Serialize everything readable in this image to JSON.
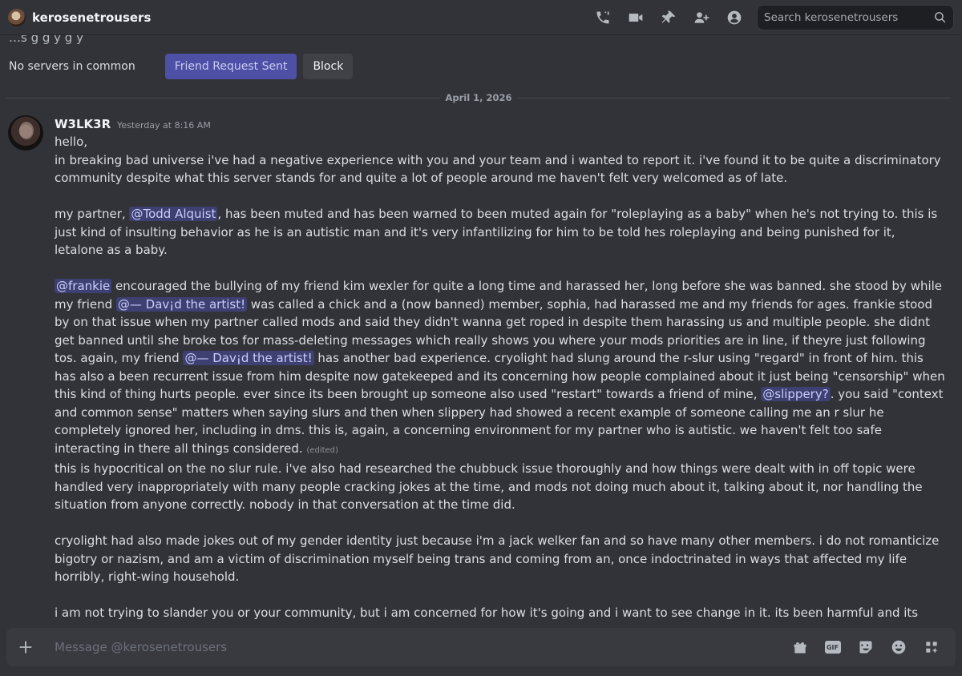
{
  "header": {
    "title": "kerosenetrousers",
    "search_placeholder": "Search kerosenetrousers"
  },
  "profile": {
    "clipped_text": "…s      g  g  y              g    y",
    "no_servers": "No servers in common",
    "friend_request_label": "Friend Request Sent",
    "block_label": "Block"
  },
  "divider": {
    "date": "April 1, 2026"
  },
  "message": {
    "author": "W3LK3R",
    "timestamp": "Yesterday at 8:16 AM",
    "edited": "(edited)",
    "p1_a": "hello,\nin breaking bad universe i've had a negative experience with you and your team and i wanted to report it. i've found it to be quite a discriminatory community despite what this server stands for and quite a lot of people around me haven't felt very welcomed as of late.",
    "p2_a": "my partner, ",
    "p2_mention": "@Todd Alquist",
    "p2_b": ", has been muted and has been warned to been muted again for \"roleplaying as a baby\" when he's not trying to. this is just kind of insulting behavior as he is an autistic man and it's very infantilizing for him to be told hes roleplaying and being punished for it, letalone as a baby.",
    "p3_m1": "@frankie",
    "p3_a": " encouraged the bullying of my friend kim wexler for quite a long time and harassed her, long before she was banned. she stood by while my friend ",
    "p3_m2": "@— Dav¡d the artist!",
    "p3_b": " was called a chick and a (now banned) member, sophia, had harassed me and my friends for ages. frankie stood by on that issue when my partner called mods and said they didn't wanna get roped in despite them harassing us and multiple people. she didnt get banned until she broke tos for mass-deleting messages which really shows you where your mods priorities are in line, if theyre just following tos. again, my friend ",
    "p3_m3": "@— Dav¡d the artist!",
    "p3_c": " has another bad experience. cryolight had slung around the r-slur using \"regard\" in front of him. this has also a been recurrent issue from him despite now gatekeeped and its concerning how people complained about it just being \"censorship\" when this kind of thing hurts people. ever since its been brought up someone also used \"restart\" towards a friend of mine, ",
    "p3_m4": "@slippery?",
    "p3_d": ". you said \"context and common sense\" matters when saying slurs and then when slippery had showed a recent example of someone calling me an r slur he completely ignored her, including in dms. this is, again, a concerning environment for my partner who is autistic. we haven't felt too safe interacting in there all things considered. ",
    "p4": "this is hypocritical on the no slur rule. i've also had researched the chubbuck issue thoroughly and how things were dealt with in off topic were handled very inappropriately with many people cracking jokes at the time, and mods not doing much about it, talking about it, nor handling the situation from anyone correctly. nobody in that conversation at the time did.",
    "p5": "cryolight had also made jokes out of my gender identity just because i'm a jack welker fan and so have many other members. i do not romanticize bigotry or nazism, and am a victim of discrimination myself being trans and coming from an, once indoctrinated in ways that affected my life horribly, right-wing household.",
    "p6": "i am not trying to slander you or your community, but i am concerned for how it's going and i want to see change in it. its been harmful and its disappointing that such a large community is being unkept. i feel as this is just the tip of the iceberg to where it comes to my complaints and i understand that this issue was just addressed recently in announcements but this complaint has also been a long time coming and i've been very wary of this server and its flaws for"
  },
  "composer": {
    "placeholder": "Message @kerosenetrousers",
    "gif_label": "GIF"
  },
  "colors": {
    "background": "#323339",
    "mention_bg": "#3d4071",
    "primary_button": "#4e50a6"
  },
  "icons": [
    "phone-icon",
    "video-icon",
    "pin-icon",
    "add-friend-icon",
    "profile-icon",
    "search-icon",
    "plus-icon",
    "gift-icon",
    "gif-icon",
    "sticker-icon",
    "emoji-icon",
    "apps-icon"
  ]
}
